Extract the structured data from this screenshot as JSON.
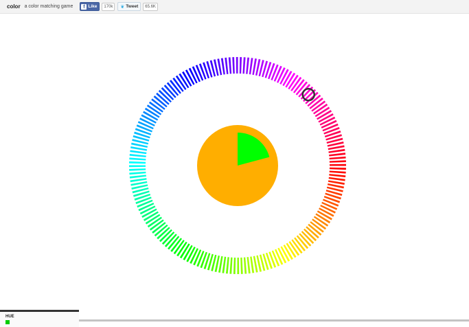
{
  "header": {
    "brand": "color",
    "tagline": "a color matching game",
    "like_label": "Like",
    "like_count": "170k",
    "tweet_label": "Tweet",
    "tweet_count": "65.6K"
  },
  "game": {
    "target_color": "#ffae00",
    "wedge_color": "#00ff00",
    "selector_hue_degrees": 45,
    "wedge_start_degrees": 0,
    "wedge_end_degrees": 75
  },
  "hud": {
    "label": "HUE",
    "swatch_color": "#00cc00"
  },
  "colors": {
    "selector_ring": "#333333",
    "fb_blue": "#3b5998",
    "twitter_blue": "#2aa9e0"
  }
}
